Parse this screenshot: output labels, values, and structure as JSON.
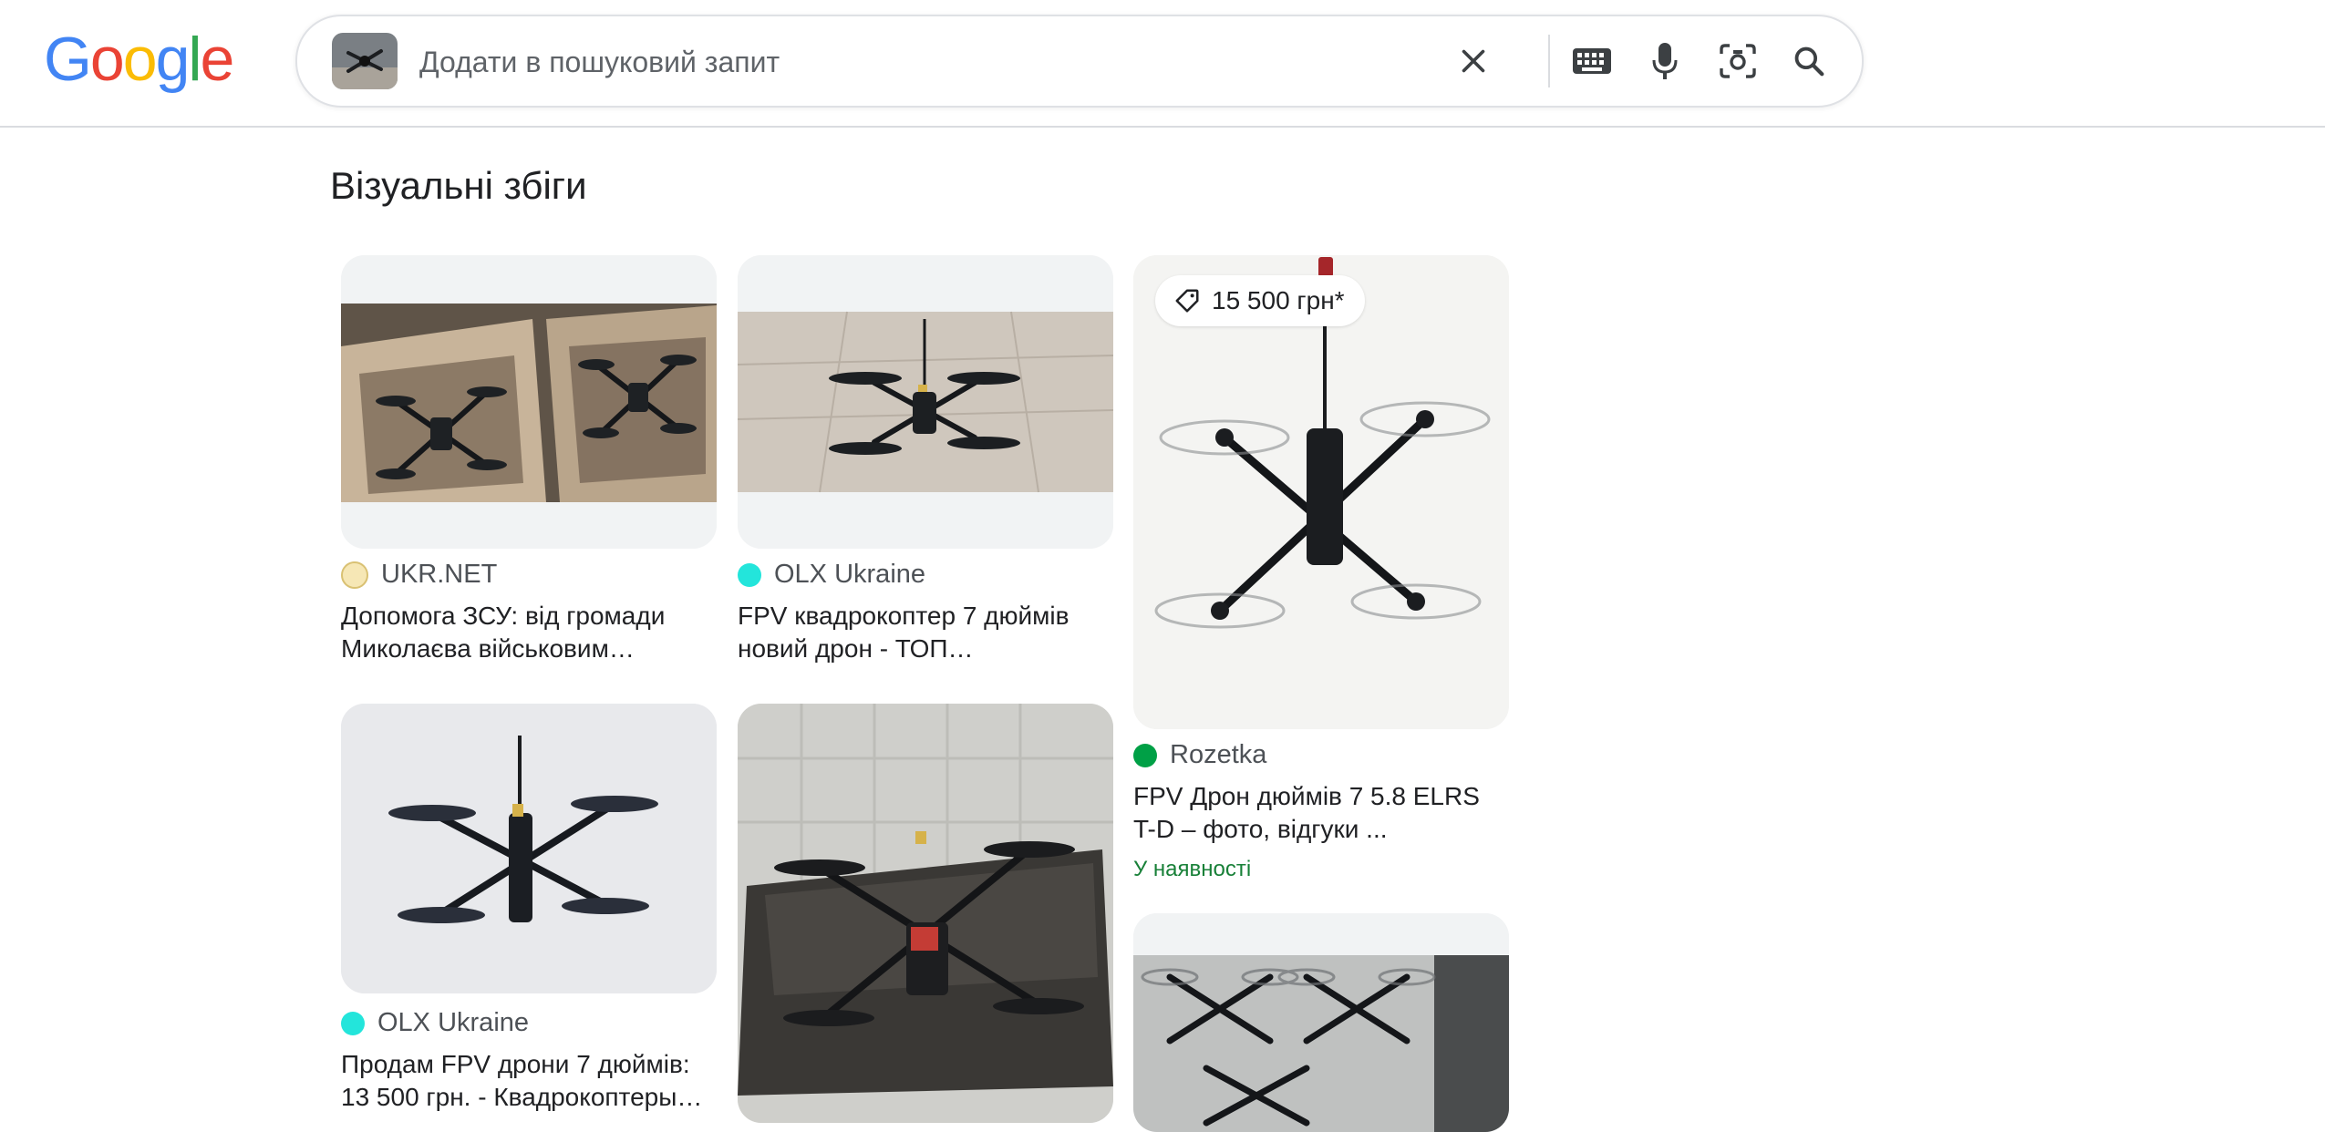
{
  "header": {
    "logo_letters": [
      "G",
      "o",
      "o",
      "g",
      "l",
      "e"
    ],
    "logo_colors": [
      "#4285F4",
      "#EA4335",
      "#FBBC05",
      "#4285F4",
      "#34A853",
      "#EA4335"
    ],
    "search": {
      "placeholder": "Додати в пошуковий запит",
      "value": ""
    },
    "icons": [
      "close-icon",
      "keyboard-icon",
      "microphone-icon",
      "lens-camera-icon",
      "search-icon"
    ]
  },
  "section": {
    "title": "Візуальні збіги"
  },
  "results": [
    {
      "source": "UKR.NET",
      "title_lines": [
        "Допомога ЗСУ: від громади",
        "Миколаєва військовим…"
      ]
    },
    {
      "source": "OLX Ukraine",
      "title_lines": [
        "FPV квадрокоптер 7 дюймів",
        "новий дрон - ТОП…"
      ]
    },
    {
      "source": "Rozetka",
      "price": "15 500 грн*",
      "title_lines": [
        "FPV Дрон дюймів 7 5.8 ELRS",
        "T-D – фото, відгуки ..."
      ],
      "availability": "У наявності"
    },
    {
      "source": "OLX Ukraine",
      "title_lines": [
        "Продам FPV дрони 7 дюймів:",
        "13 500 грн. - Квадрокоптеры…"
      ]
    }
  ],
  "colors": {
    "availability": "#188038",
    "olx_favicon": "#23e5db",
    "rozetka_favicon": "#00a046"
  }
}
